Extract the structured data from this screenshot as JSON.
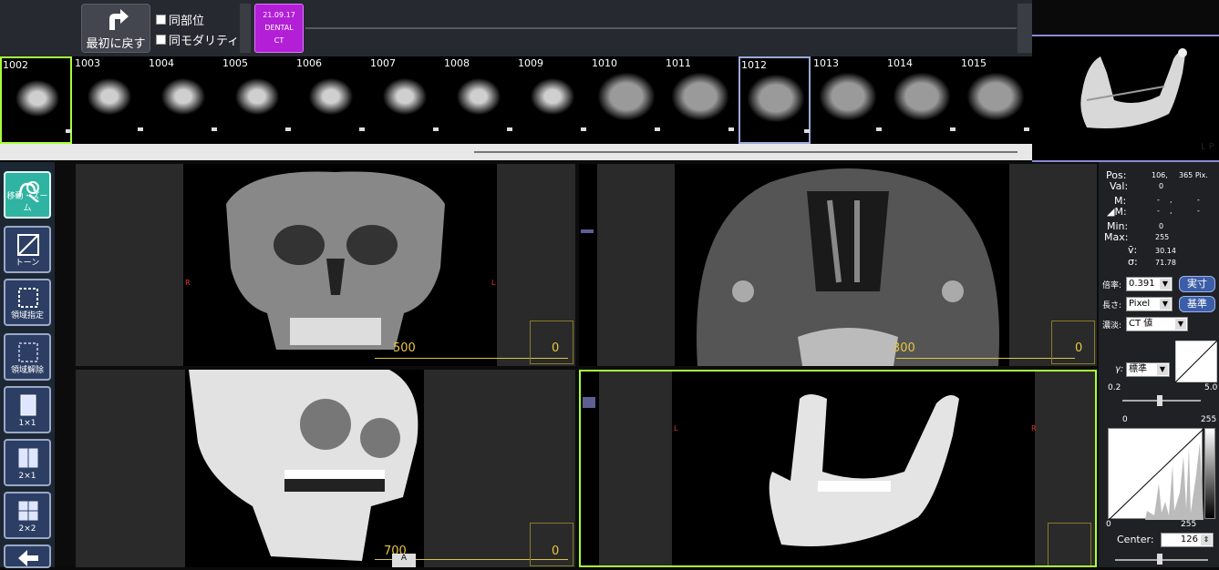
{
  "top": {
    "reset_label": "最初に戻す",
    "same_site_label": "同部位",
    "same_modality_label": "同モダリティ",
    "study": {
      "date": "21.09.17",
      "desc": "DENTAL",
      "modality": "CT"
    }
  },
  "thumbnails": [
    {
      "num": "1002"
    },
    {
      "num": "1003"
    },
    {
      "num": "1004"
    },
    {
      "num": "1005"
    },
    {
      "num": "1006"
    },
    {
      "num": "1007"
    },
    {
      "num": "1008"
    },
    {
      "num": "1009"
    },
    {
      "num": "1010"
    },
    {
      "num": "1011"
    },
    {
      "num": "1012"
    },
    {
      "num": "1013"
    },
    {
      "num": "1014"
    },
    {
      "num": "1015"
    }
  ],
  "preview": {
    "orientation": "L P"
  },
  "tools": [
    {
      "label": "移動・ズーム"
    },
    {
      "label": "トーン"
    },
    {
      "label": "領域指定"
    },
    {
      "label": "領域解除"
    },
    {
      "label": "1×1"
    },
    {
      "label": "2×1"
    },
    {
      "label": "2×2"
    },
    {
      "label": ""
    }
  ],
  "viewports": [
    {
      "scale": "500",
      "scale_end": "0",
      "left": "R",
      "right": "L"
    },
    {
      "scale": "300",
      "scale_end": "0",
      "left": "",
      "right": ""
    },
    {
      "scale": "700",
      "scale_end": "0",
      "left": "",
      "right": "",
      "corner": "A"
    },
    {
      "scale": "",
      "scale_end": "",
      "left": "L",
      "right": "R"
    }
  ],
  "stats": {
    "pos_label": "Pos:",
    "pos_val": "106,",
    "pos_unit": "365 Pix.",
    "val_label": "Val:",
    "val_val": "0",
    "m_label": "M:",
    "m_val1": "-",
    "m_val2": ",",
    "m_val3": "-",
    "dm_label": "◢M:",
    "dm_val1": "-",
    "dm_val2": ",",
    "dm_val3": "-",
    "min_label": "Min:",
    "min_val": "0",
    "max_label": "Max:",
    "max_val": "255",
    "mean_label": "v̄:",
    "mean_val": "30.14",
    "sd_label": "σ:",
    "sd_val": "71.78"
  },
  "controls": {
    "zoom_label": "倍率:",
    "zoom_value": "0.391",
    "actual_btn": "実寸",
    "length_label": "長さ:",
    "length_value": "Pixel",
    "standard_btn": "基準",
    "density_label": "濃淡:",
    "density_value": "CT 値",
    "gamma_label": "γ:",
    "gamma_value": "標準",
    "gamma_min": "0.2",
    "gamma_max": "5.0",
    "hist_top_min": "0",
    "hist_top_max": "255",
    "hist_bottom_min": "0",
    "hist_bottom_max": "255",
    "center_label": "Center:",
    "center_value": "126"
  }
}
